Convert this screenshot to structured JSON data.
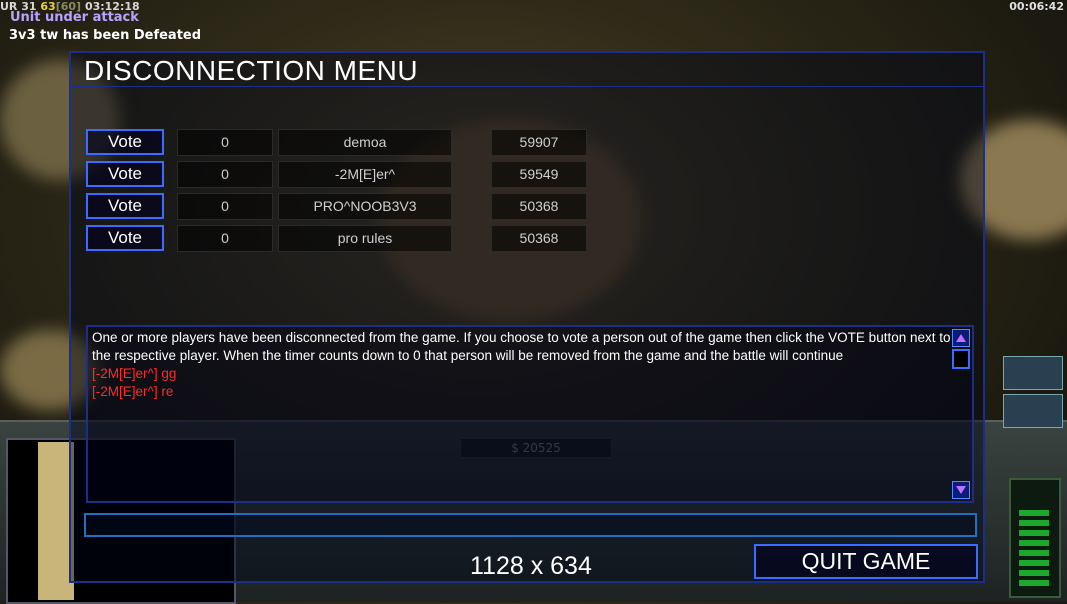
{
  "hud": {
    "status_prefix": "UR",
    "stat_a": "31",
    "stat_b": "63",
    "stat_c": "[60]",
    "game_time": "03:12:18",
    "clock": "00:06:42",
    "message_1": "Unit under attack",
    "message_2": "3v3 tw has been Defeated",
    "money": "$ 20525"
  },
  "dialog": {
    "title": "DISCONNECTION MENU",
    "vote_label": "Vote",
    "players": [
      {
        "votes": "0",
        "name": "demoa",
        "timer": "59907"
      },
      {
        "votes": "0",
        "name": "-2M[E]er^",
        "timer": "59549"
      },
      {
        "votes": "0",
        "name": "PRO^NOOB3V3",
        "timer": "50368"
      },
      {
        "votes": "0",
        "name": "pro rules",
        "timer": "50368"
      }
    ],
    "chat_info": "One or more players have been disconnected from the game. If you choose to vote a person out of the game then click the VOTE button next to the respective player. When the timer counts down to 0 that person will be removed from the game and the battle will continue",
    "chat_lines": [
      "[-2M[E]er^] gg",
      "[-2M[E]er^] re"
    ],
    "chat_input": "",
    "quit_label": "QUIT GAME"
  },
  "overlay_resolution": "1128 x 634",
  "colors": {
    "accent_border": "#3a6cff",
    "chat_red": "#ff2a2a",
    "defeat_msg": "#b9a3ff"
  }
}
